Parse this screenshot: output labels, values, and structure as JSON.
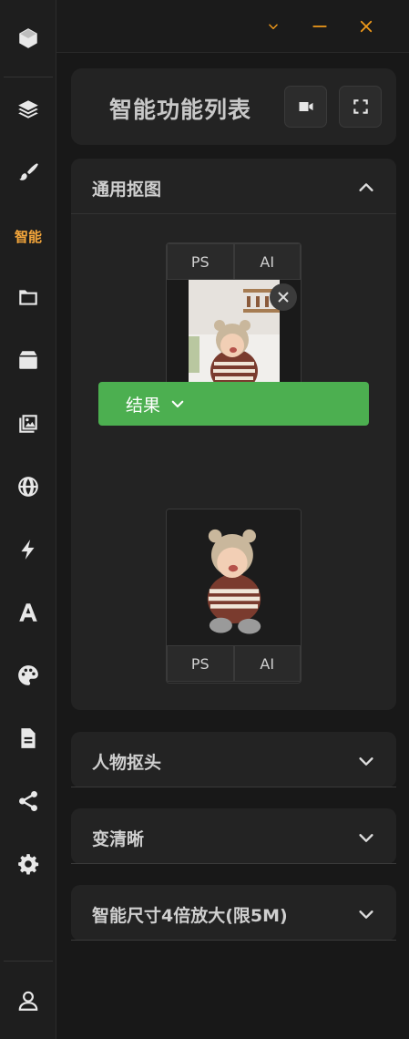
{
  "sidebar": {
    "items": [
      {
        "name": "cube-icon"
      },
      {
        "name": "layers-icon"
      },
      {
        "name": "brush-icon"
      },
      {
        "label": "智能"
      },
      {
        "name": "folder-icon"
      },
      {
        "name": "box-icon"
      },
      {
        "name": "images-icon"
      },
      {
        "name": "globe-icon"
      },
      {
        "name": "bolt-icon"
      },
      {
        "name": "font-icon"
      },
      {
        "name": "palette-icon"
      },
      {
        "name": "document-icon"
      },
      {
        "name": "share-icon"
      },
      {
        "name": "gear-icon"
      },
      {
        "name": "user-icon"
      }
    ]
  },
  "window": {
    "accent": "#f09a1a"
  },
  "header": {
    "title": "智能功能列表"
  },
  "sections": {
    "cutout": {
      "title": "通用抠图",
      "expanded": true,
      "input_buttons": [
        "PS",
        "AI"
      ],
      "result_label": "结果",
      "output_buttons": [
        "PS",
        "AI"
      ]
    },
    "portrait": {
      "title": "人物抠头",
      "expanded": false
    },
    "sharpen": {
      "title": "变清晰",
      "expanded": false
    },
    "upscale": {
      "title": "智能尺寸4倍放大(限5M)",
      "expanded": false
    }
  },
  "colors": {
    "result_button": "#4caf50",
    "active_sidebar": "#f4a63b"
  }
}
